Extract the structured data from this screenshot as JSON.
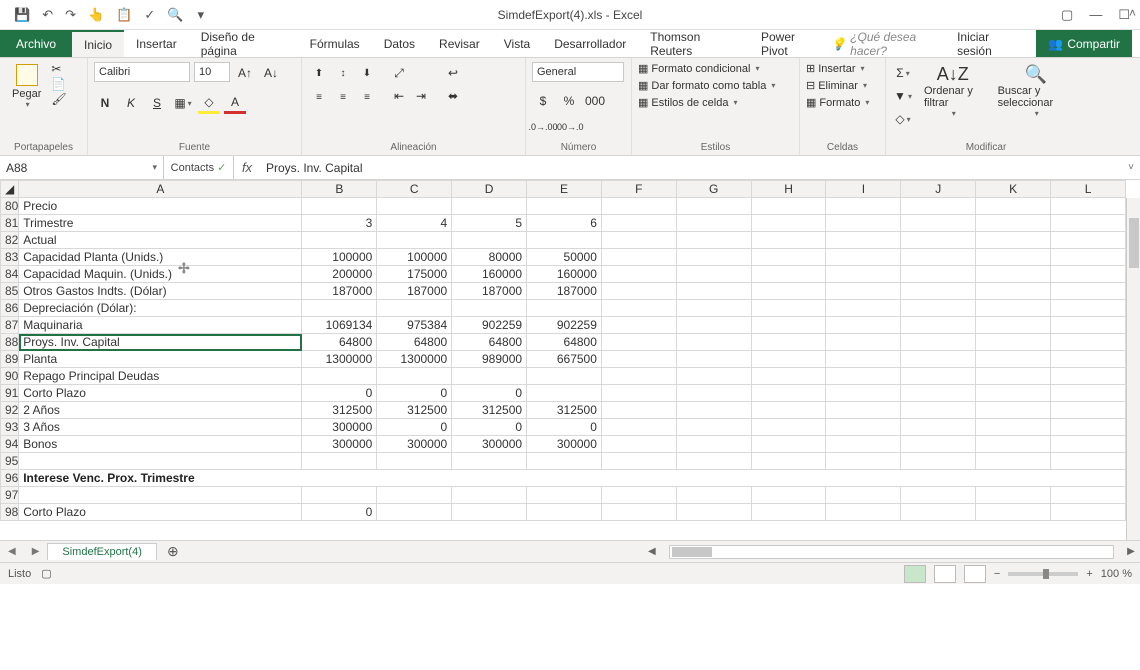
{
  "title": "SimdefExport(4).xls - Excel",
  "qat": {
    "save": "💾",
    "undo": "↶",
    "redo": "↷"
  },
  "tabs": {
    "file": "Archivo",
    "home": "Inicio",
    "insert": "Insertar",
    "layout": "Diseño de página",
    "formulas": "Fórmulas",
    "data": "Datos",
    "review": "Revisar",
    "view": "Vista",
    "developer": "Desarrollador",
    "thomson": "Thomson Reuters",
    "powerpivot": "Power Pivot"
  },
  "tell_me": "¿Qué desea hacer?",
  "signin": "Iniciar sesión",
  "share": "Compartir",
  "ribbon": {
    "clipboard": {
      "paste": "Pegar",
      "label": "Portapapeles"
    },
    "font": {
      "name": "Calibri",
      "size": "10",
      "label": "Fuente",
      "bold": "N",
      "italic": "K",
      "underline": "S"
    },
    "alignment": {
      "label": "Alineación"
    },
    "number": {
      "format": "General",
      "label": "Número"
    },
    "styles": {
      "cond": "Formato condicional",
      "table": "Dar formato como tabla",
      "cell": "Estilos de celda",
      "label": "Estilos"
    },
    "cells": {
      "insert": "Insertar",
      "delete": "Eliminar",
      "format": "Formato",
      "label": "Celdas"
    },
    "editing": {
      "sort": "Ordenar y filtrar",
      "find": "Buscar y seleccionar",
      "label": "Modificar"
    }
  },
  "namebox": "A88",
  "contacts": "Contacts",
  "formula": "Proys. Inv. Capital",
  "columns": [
    "A",
    "B",
    "C",
    "D",
    "E",
    "F",
    "G",
    "H",
    "I",
    "J",
    "K",
    "L"
  ],
  "rows": [
    {
      "n": 80,
      "a": "Precio",
      "b": "",
      "c": "",
      "d": "",
      "e": ""
    },
    {
      "n": 81,
      "a": "Trimestre",
      "b": "3",
      "c": "4",
      "d": "5",
      "e": "6"
    },
    {
      "n": 82,
      "a": "Actual",
      "b": "",
      "c": "",
      "d": "",
      "e": ""
    },
    {
      "n": 83,
      "a": "Capacidad Planta (Unids.)",
      "b": "100000",
      "c": "100000",
      "d": "80000",
      "e": "50000"
    },
    {
      "n": 84,
      "a": "Capacidad Maquin. (Unids.)",
      "b": "200000",
      "c": "175000",
      "d": "160000",
      "e": "160000"
    },
    {
      "n": 85,
      "a": "Otros Gastos Indts. (Dólar)",
      "b": "187000",
      "c": "187000",
      "d": "187000",
      "e": "187000"
    },
    {
      "n": 86,
      "a": "Depreciación (Dólar):",
      "b": "",
      "c": "",
      "d": "",
      "e": ""
    },
    {
      "n": 87,
      "a": "Maquinaria",
      "b": "1069134",
      "c": "975384",
      "d": "902259",
      "e": "902259"
    },
    {
      "n": 88,
      "a": "Proys. Inv. Capital",
      "b": "64800",
      "c": "64800",
      "d": "64800",
      "e": "64800",
      "selected": true
    },
    {
      "n": 89,
      "a": "Planta",
      "b": "1300000",
      "c": "1300000",
      "d": "989000",
      "e": "667500"
    },
    {
      "n": 90,
      "a": "Repago Principal Deudas",
      "b": "",
      "c": "",
      "d": "",
      "e": ""
    },
    {
      "n": 91,
      "a": "Corto Plazo",
      "b": "0",
      "c": "0",
      "d": "0",
      "e": ""
    },
    {
      "n": 92,
      "a": "2 Años",
      "b": "312500",
      "c": "312500",
      "d": "312500",
      "e": "312500"
    },
    {
      "n": 93,
      "a": "3 Años",
      "b": "300000",
      "c": "0",
      "d": "0",
      "e": "0"
    },
    {
      "n": 94,
      "a": "Bonos",
      "b": "300000",
      "c": "300000",
      "d": "300000",
      "e": "300000"
    },
    {
      "n": 95,
      "a": "",
      "b": "",
      "c": "",
      "d": "",
      "e": ""
    },
    {
      "n": 96,
      "a": "Interese Venc. Prox. Trimestre",
      "heading": true
    },
    {
      "n": 97,
      "a": "",
      "b": "",
      "c": "",
      "d": "",
      "e": ""
    },
    {
      "n": 98,
      "a": "Corto Plazo",
      "b": "0",
      "c": "",
      "d": "",
      "e": ""
    }
  ],
  "sheet_tab": "SimdefExport(4)",
  "status": "Listo",
  "zoom": "100 %"
}
